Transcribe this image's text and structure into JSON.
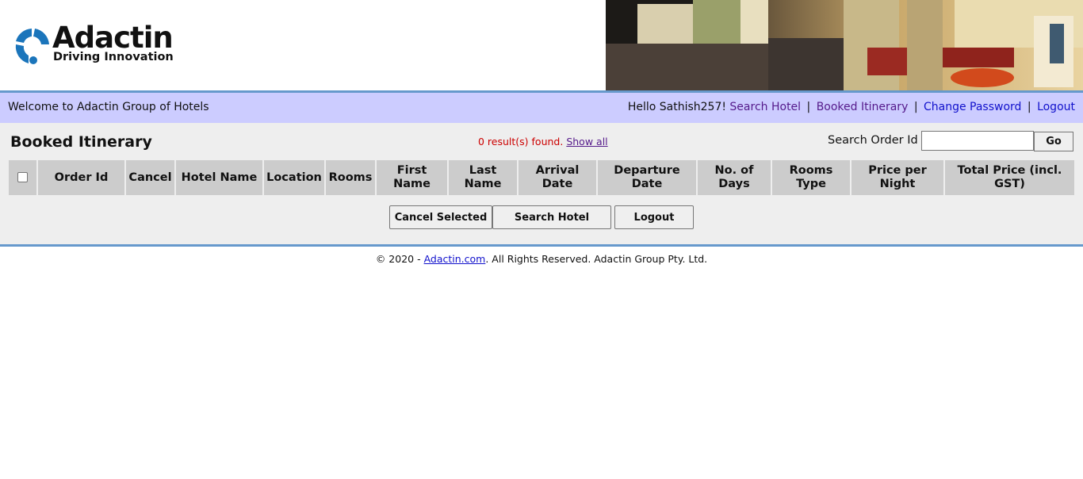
{
  "brand": {
    "name": "Adactin",
    "tagline": "Driving Innovation",
    "colors": {
      "blue": "#1b75bb",
      "dark": "#111111"
    }
  },
  "topbar": {
    "welcome": "Welcome to Adactin Group of Hotels",
    "greeting": "Hello Sathish257!",
    "links": [
      "Search Hotel",
      "Booked Itinerary",
      "Change Password",
      "Logout"
    ],
    "separator": "|",
    "background": "#ccccff",
    "border_color": "#6699cc"
  },
  "main": {
    "title": "Booked Itinerary",
    "results_text": "0 result(s) found.",
    "show_all": "Show all",
    "search": {
      "label": "Search Order Id",
      "value": "",
      "placeholder": "",
      "go_label": "Go"
    },
    "columns": [
      "Order Id",
      "Cancel",
      "Hotel Name",
      "Location",
      "Rooms",
      "First Name",
      "Last Name",
      "Arrival Date",
      "Departure Date",
      "No. of Days",
      "Rooms Type",
      "Price per Night",
      "Total Price (incl. GST)"
    ],
    "buttons": {
      "cancel_selected": "Cancel Selected",
      "search_hotel": "Search Hotel",
      "logout": "Logout"
    }
  },
  "footer": {
    "prefix": "© 2020 - ",
    "link": "Adactin.com",
    "suffix": ". All Rights Reserved. Adactin Group Pty. Ltd."
  }
}
